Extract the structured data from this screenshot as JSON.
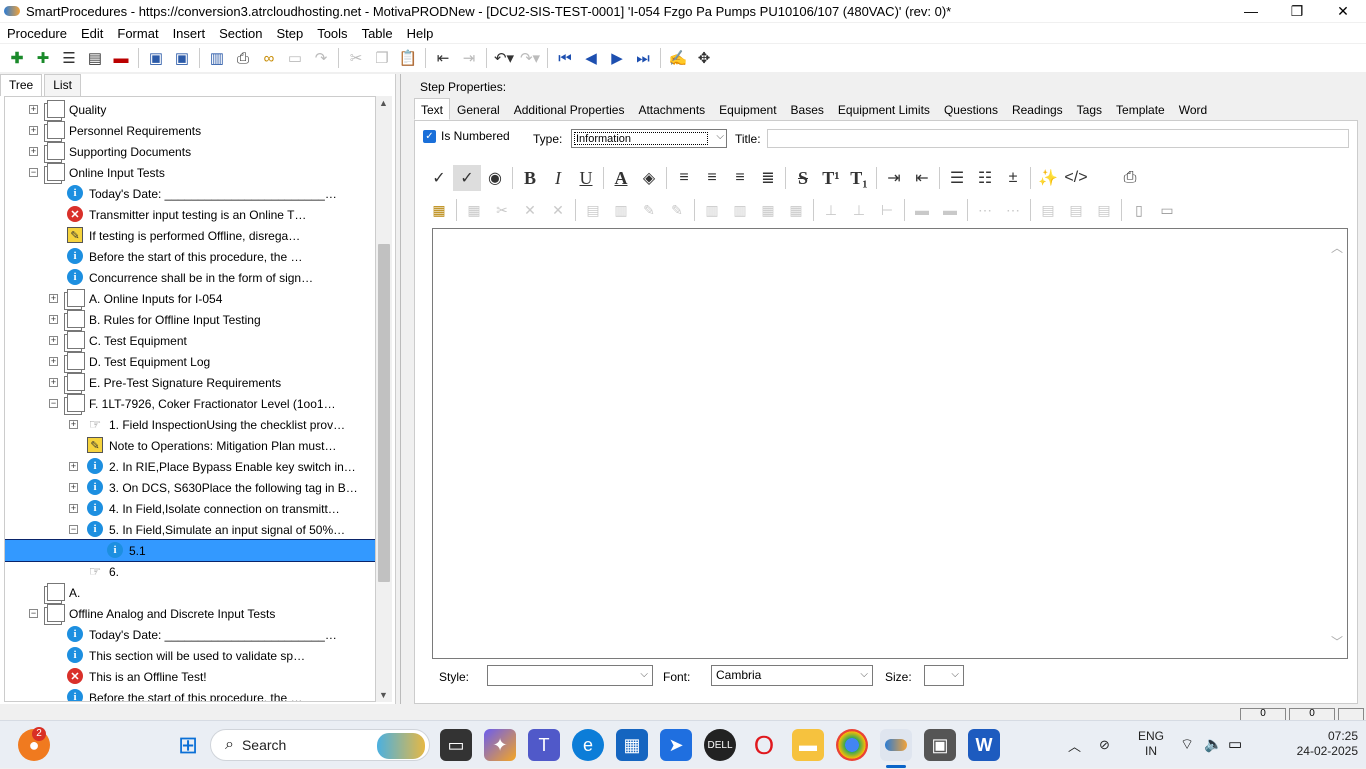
{
  "window": {
    "title": "SmartProcedures - https://conversion3.atrcloudhosting.net - MotivaPRODNew - [DCU2-SIS-TEST-0001] 'I-054 Fzgo Pa Pumps PU10106/107 (480VAC)' (rev: 0)*",
    "controls": {
      "minimize": "—",
      "restore": "❐",
      "close": "✕"
    }
  },
  "menu": [
    "Procedure",
    "Edit",
    "Format",
    "Insert",
    "Section",
    "Step",
    "Tools",
    "Table",
    "Help"
  ],
  "toolbar": {
    "icons": [
      "add-icon",
      "add-child-icon",
      "list-icon",
      "list-alt-icon",
      "remove-icon",
      "save-all-icon",
      "save-icon",
      "publish-icon",
      "print-icon",
      "link-icon",
      "panel-icon",
      "redo-step-icon",
      "cut-icon",
      "copy-icon",
      "paste-icon",
      "outdent-icon",
      "indent-icon",
      "undo-icon",
      "redo-icon",
      "first-icon",
      "previous-icon",
      "next-icon",
      "last-icon",
      "spellcheck-icon",
      "move-icon"
    ]
  },
  "left_tabs": [
    "Tree",
    "List"
  ],
  "tree": [
    {
      "label": "Quality",
      "icon": "doc",
      "level": 1,
      "exp": "+"
    },
    {
      "label": "Personnel Requirements",
      "icon": "doc",
      "level": 1,
      "exp": "+"
    },
    {
      "label": "Supporting Documents",
      "icon": "doc",
      "level": 1,
      "exp": "+"
    },
    {
      "label": "Online Input Tests",
      "icon": "doc",
      "level": 1,
      "exp": "−"
    },
    {
      "label": "Today's Date: ________________________…",
      "icon": "info",
      "level": 2,
      "exp": ""
    },
    {
      "label": "Transmitter input testing is an Online T…",
      "icon": "err",
      "level": 2,
      "exp": ""
    },
    {
      "label": "If testing is performed Offline, disrega…",
      "icon": "note",
      "level": 2,
      "exp": ""
    },
    {
      "label": "Before the start of this procedure, the …",
      "icon": "info",
      "level": 2,
      "exp": ""
    },
    {
      "label": "Concurrence shall be in the form of sign…",
      "icon": "info",
      "level": 2,
      "exp": ""
    },
    {
      "label": "A. Online Inputs for I-054",
      "icon": "doc",
      "level": 2,
      "exp": "+"
    },
    {
      "label": "B. Rules for Offline Input Testing",
      "icon": "doc",
      "level": 2,
      "exp": "+"
    },
    {
      "label": "C. Test Equipment",
      "icon": "doc",
      "level": 2,
      "exp": "+"
    },
    {
      "label": "D. Test Equipment Log",
      "icon": "doc",
      "level": 2,
      "exp": "+"
    },
    {
      "label": "E. Pre-Test Signature Requirements",
      "icon": "doc",
      "level": 2,
      "exp": "+"
    },
    {
      "label": "F. 1LT-7926, Coker Fractionator Level (1oo1…",
      "icon": "doc",
      "level": 2,
      "exp": "−"
    },
    {
      "label": "1. Field InspectionUsing the checklist prov…",
      "icon": "hand",
      "level": 3,
      "exp": "+"
    },
    {
      "label": "Note to Operations: Mitigation Plan must…",
      "icon": "note",
      "level": 3,
      "exp": ""
    },
    {
      "label": "2. In RIE,Place Bypass Enable key switch in…",
      "icon": "info",
      "level": 3,
      "exp": "+"
    },
    {
      "label": "3. On DCS, S630Place the following tag in B…",
      "icon": "info",
      "level": 3,
      "exp": "+"
    },
    {
      "label": "4. In Field,Isolate connection on transmitt…",
      "icon": "info",
      "level": 3,
      "exp": "+"
    },
    {
      "label": "5. In Field,Simulate an input signal of 50%…",
      "icon": "info",
      "level": 3,
      "exp": "−"
    },
    {
      "label": "5.1",
      "icon": "info",
      "level": 4,
      "exp": "",
      "selected": true
    },
    {
      "label": "6.",
      "icon": "hand",
      "level": 3,
      "exp": ""
    },
    {
      "label": "A.",
      "icon": "doc",
      "level": 1,
      "exp": ""
    },
    {
      "label": "Offline Analog and Discrete Input Tests",
      "icon": "doc",
      "level": 1,
      "exp": "−"
    },
    {
      "label": "Today's Date: ________________________…",
      "icon": "info",
      "level": 2,
      "exp": ""
    },
    {
      "label": "This section will be used to validate sp…",
      "icon": "info",
      "level": 2,
      "exp": ""
    },
    {
      "label": "This is an Offline Test!",
      "icon": "err",
      "level": 2,
      "exp": ""
    },
    {
      "label": "Before the start of this procedure, the …",
      "icon": "info",
      "level": 2,
      "exp": ""
    }
  ],
  "step_properties": {
    "heading": "Step Properties:",
    "tabs": [
      "Text",
      "General",
      "Additional Properties",
      "Attachments",
      "Equipment",
      "Bases",
      "Equipment Limits",
      "Questions",
      "Readings",
      "Tags",
      "Template",
      "Word"
    ],
    "is_numbered_label": "Is Numbered",
    "is_numbered": true,
    "type_label": "Type:",
    "type_value": "Information",
    "title_label": "Title:",
    "title_value": "",
    "style_label": "Style:",
    "style_value": "",
    "font_label": "Font:",
    "font_value": "Cambria",
    "size_label": "Size:",
    "size_value": ""
  },
  "status": {
    "box1": "0",
    "box2": "0"
  },
  "taskbar": {
    "search_placeholder": "Search",
    "notif_count": "2",
    "lang_top": "ENG",
    "lang_bottom": "IN",
    "time": "07:25",
    "date": "24-02-2025"
  },
  "colors": {
    "selection": "#3399ff",
    "info": "#1d8fe0",
    "error": "#d9302a",
    "note": "#f5d33d"
  }
}
